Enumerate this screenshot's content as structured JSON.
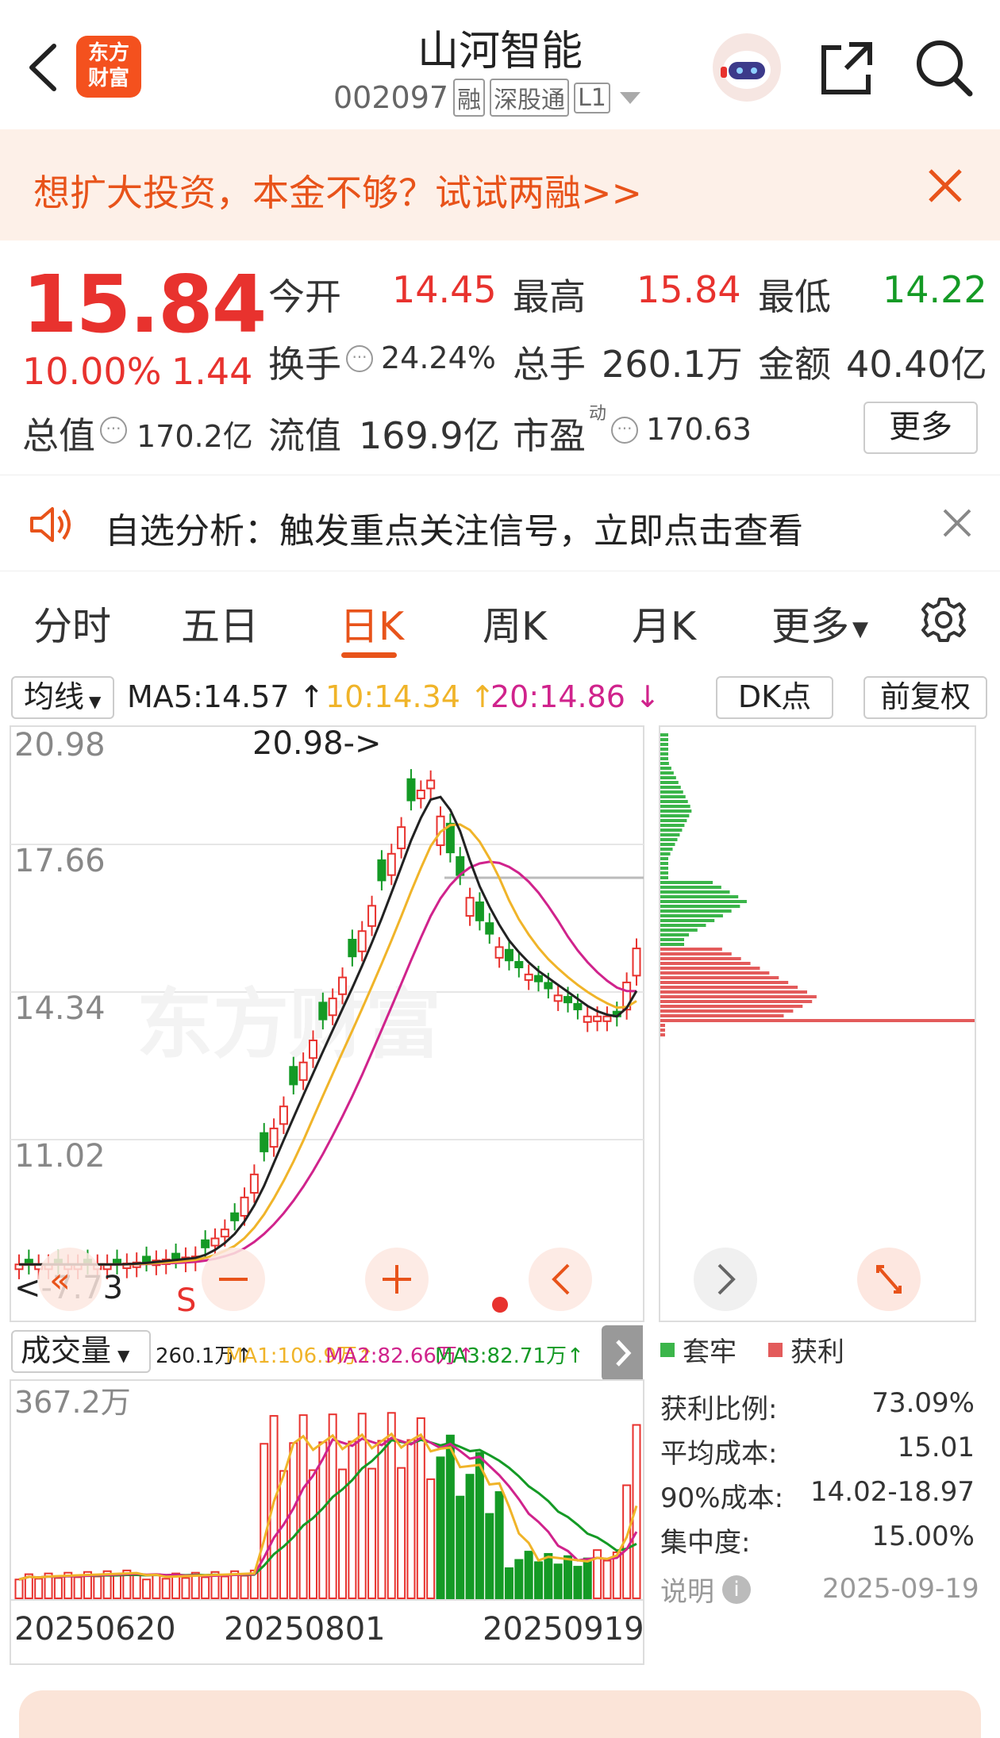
{
  "header": {
    "title": "山河智能",
    "code": "002097",
    "tags": [
      "融",
      "深股通",
      "L1"
    ],
    "logo_text_line1": "东方",
    "logo_text_line2": "财富"
  },
  "banner": {
    "text": "想扩大投资，本金不够？试试两融>>"
  },
  "quote": {
    "price": "15.84",
    "change_pct": "10.00%",
    "change": "1.44",
    "open_label": "今开",
    "open": "14.45",
    "high_label": "最高",
    "high": "15.84",
    "low_label": "最低",
    "low": "14.22",
    "turnover_label": "换手",
    "turnover": "24.24%",
    "volume_label": "总手",
    "volume": "260.1万",
    "amount_label": "金额",
    "amount": "40.40亿",
    "mktcap_label": "总值",
    "mktcap": "170.2亿",
    "float_label": "流值",
    "float": "169.9亿",
    "pe_label": "市盈",
    "pe_sup": "动",
    "pe": "170.63",
    "more_label": "更多"
  },
  "notice": {
    "text": "自选分析：触发重点关注信号，立即点击查看"
  },
  "tabs": [
    "分时",
    "五日",
    "日K",
    "周K",
    "月K",
    "更多"
  ],
  "active_tab": "日K",
  "ma_bar": {
    "selector": "均线",
    "ma5": "MA5:14.57 ↑",
    "ma10": "10:14.34 ↑",
    "ma20": "20:14.86 ↓",
    "dk_label": "DK点",
    "adjust_label": "前复权"
  },
  "kline": {
    "y_labels": [
      "20.98",
      "17.66",
      "14.34",
      "11.02"
    ],
    "max_marker": "20.98->",
    "min_marker": "<-7.73",
    "s_marker": "S",
    "watermark": "东方财富"
  },
  "volume_bar": {
    "selector": "成交量",
    "vol": "260.1万↑",
    "ma1": "MA1:106.9万↑",
    "ma2": "MA2:82.66万↑",
    "ma3": "MA3:82.71万↑",
    "y_label": "367.2万",
    "dates": [
      "20250620",
      "20250801",
      "20250919"
    ]
  },
  "chip": {
    "legend_trapped": "套牢",
    "legend_profit": "获利",
    "rows": [
      {
        "label": "获利比例:",
        "value": "73.09%"
      },
      {
        "label": "平均成本:",
        "value": "15.01"
      },
      {
        "label": "90%成本:",
        "value": "14.02-18.97"
      },
      {
        "label": "集中度:",
        "value": "15.00%"
      }
    ],
    "note_label": "说明",
    "date": "2025-09-19"
  },
  "colors": {
    "up": "#e8322e",
    "down": "#149a25",
    "accent": "#e8531a",
    "ma5": "#222222",
    "ma10": "#f0b429",
    "ma20": "#d0238c"
  }
}
